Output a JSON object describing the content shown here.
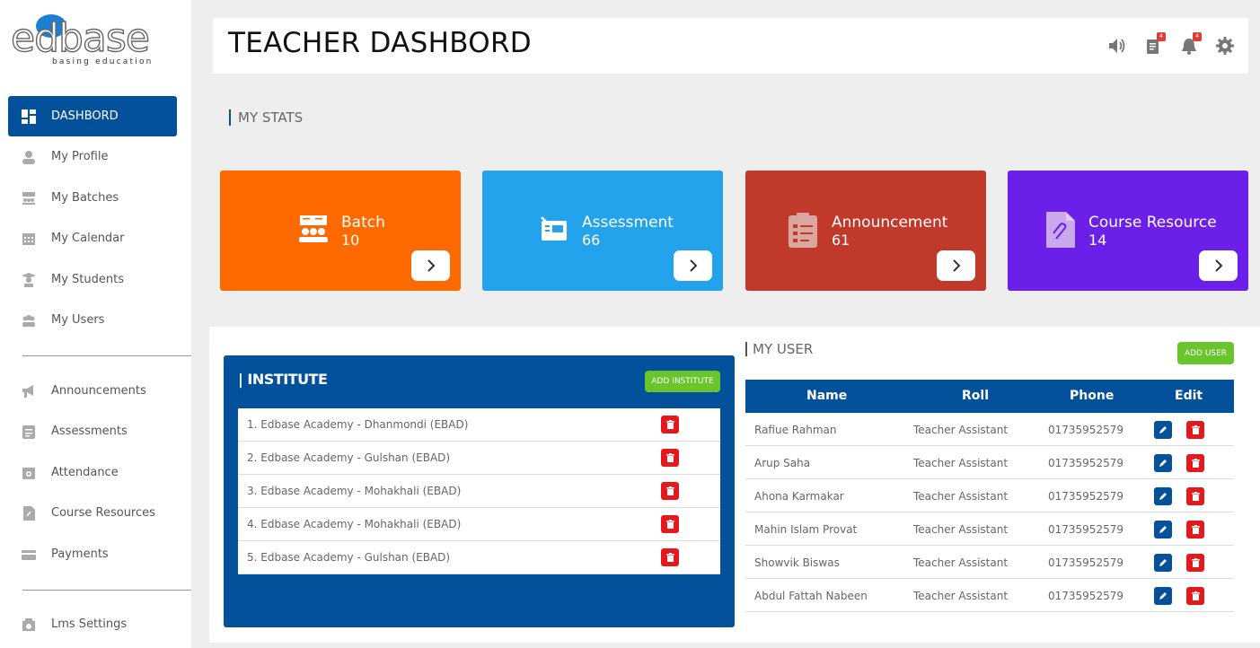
{
  "logo": {
    "text": "edbase",
    "tagline": "basing education"
  },
  "sidebar": {
    "items": [
      {
        "label": "DASHBORD",
        "icon": "dashboard-icon"
      },
      {
        "label": "My Profile",
        "icon": "user-icon"
      },
      {
        "label": "My Batches",
        "icon": "batches-icon"
      },
      {
        "label": "My Calendar",
        "icon": "calendar-icon"
      },
      {
        "label": "My Students",
        "icon": "student-icon"
      },
      {
        "label": "My Users",
        "icon": "users-icon"
      },
      {
        "label": "Announcements",
        "icon": "megaphone-icon"
      },
      {
        "label": "Assessments",
        "icon": "assessment-icon"
      },
      {
        "label": "Attendance",
        "icon": "attendance-icon"
      },
      {
        "label": "Course Resources",
        "icon": "resource-icon"
      },
      {
        "label": "Payments",
        "icon": "card-icon"
      },
      {
        "label": "Lms Settings",
        "icon": "settings-icon"
      }
    ]
  },
  "header": {
    "title": "TEACHER DASHBORD",
    "notes_badge": "4",
    "bell_badge": "4"
  },
  "stats": {
    "label": "MY STATS",
    "cards": [
      {
        "title": "Batch",
        "value": "10",
        "color": "#ff6a00"
      },
      {
        "title": "Assessment",
        "value": "66",
        "color": "#22a3ec"
      },
      {
        "title": "Announcement",
        "value": "61",
        "color": "#c0392b"
      },
      {
        "title": "Course Resource",
        "value": "14",
        "color": "#6b1fe8"
      }
    ]
  },
  "institute": {
    "title": "| INSTITUTE",
    "add_label": "ADD INSTITUTE",
    "items": [
      "1. Edbase Academy - Dhanmondi (EBAD)",
      "2. Edbase Academy - Gulshan (EBAD)",
      "3. Edbase Academy - Mohakhali (EBAD)",
      "4. Edbase Academy - Mohakhali (EBAD)",
      "5. Edbase Academy - Gulshan (EBAD)"
    ]
  },
  "users": {
    "title": "MY USER",
    "add_label": "ADD USER",
    "columns": [
      "Name",
      "Roll",
      "Phone",
      "Edit"
    ],
    "rows": [
      {
        "name": "Rafiue Rahman",
        "roll": "Teacher Assistant",
        "phone": "01735952579"
      },
      {
        "name": "Arup Saha",
        "roll": "Teacher Assistant",
        "phone": "01735952579"
      },
      {
        "name": "Ahona Karmakar",
        "roll": "Teacher Assistant",
        "phone": "01735952579"
      },
      {
        "name": "Mahin Islam Provat",
        "roll": "Teacher Assistant",
        "phone": "01735952579"
      },
      {
        "name": "Showvik Biswas",
        "roll": "Teacher Assistant",
        "phone": "01735952579"
      },
      {
        "name": "Abdul Fattah Nabeen",
        "roll": "Teacher Assistant",
        "phone": "01735952579"
      }
    ]
  }
}
